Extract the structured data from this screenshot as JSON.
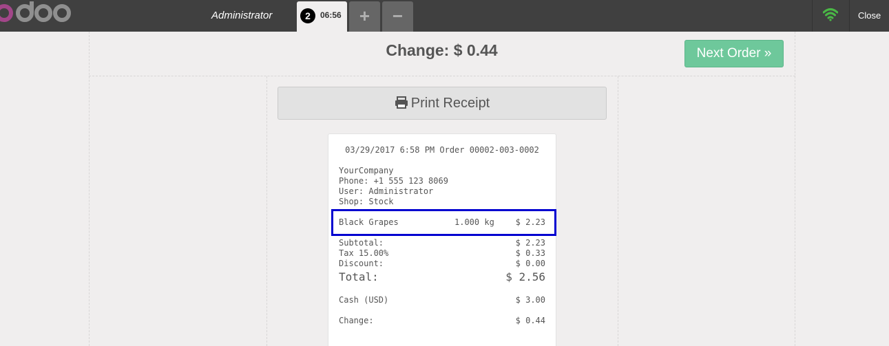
{
  "header": {
    "logo_alt": "odoo",
    "user": "Administrator",
    "order_number": "2",
    "order_time": "06:56",
    "add_order_symbol": "+",
    "remove_order_symbol": "−",
    "close_label": "Close",
    "wifi_icon": "wifi-icon",
    "wifi_color": "#4ab846"
  },
  "payment_screen": {
    "change_title": "Change: $ 0.44",
    "next_order_label": "Next Order »",
    "print_receipt_label": "Print Receipt",
    "print_icon": "printer-icon",
    "next_order_color": "#6ec89b"
  },
  "receipt": {
    "header_line": "03/29/2017 6:58 PM Order 00002-003-0002",
    "company": "YourCompany",
    "phone": "Phone: +1 555 123 8069",
    "user": "User: Administrator",
    "shop": "Shop: Stock",
    "lines": [
      {
        "product": "Black Grapes",
        "qty": "1.000 kg",
        "price": "$ 2.23"
      }
    ],
    "subtotal": {
      "label": "Subtotal:",
      "value": "$ 2.23"
    },
    "tax": {
      "label": "Tax 15.00%",
      "value": "$ 0.33"
    },
    "discount": {
      "label": "Discount:",
      "value": "$ 0.00"
    },
    "total": {
      "label": "Total:",
      "value": "$ 2.56"
    },
    "cash": {
      "label": "Cash (USD)",
      "value": "$ 3.00"
    },
    "change": {
      "label": "Change:",
      "value": "$ 0.44"
    },
    "highlight_color": "#0000d0"
  }
}
